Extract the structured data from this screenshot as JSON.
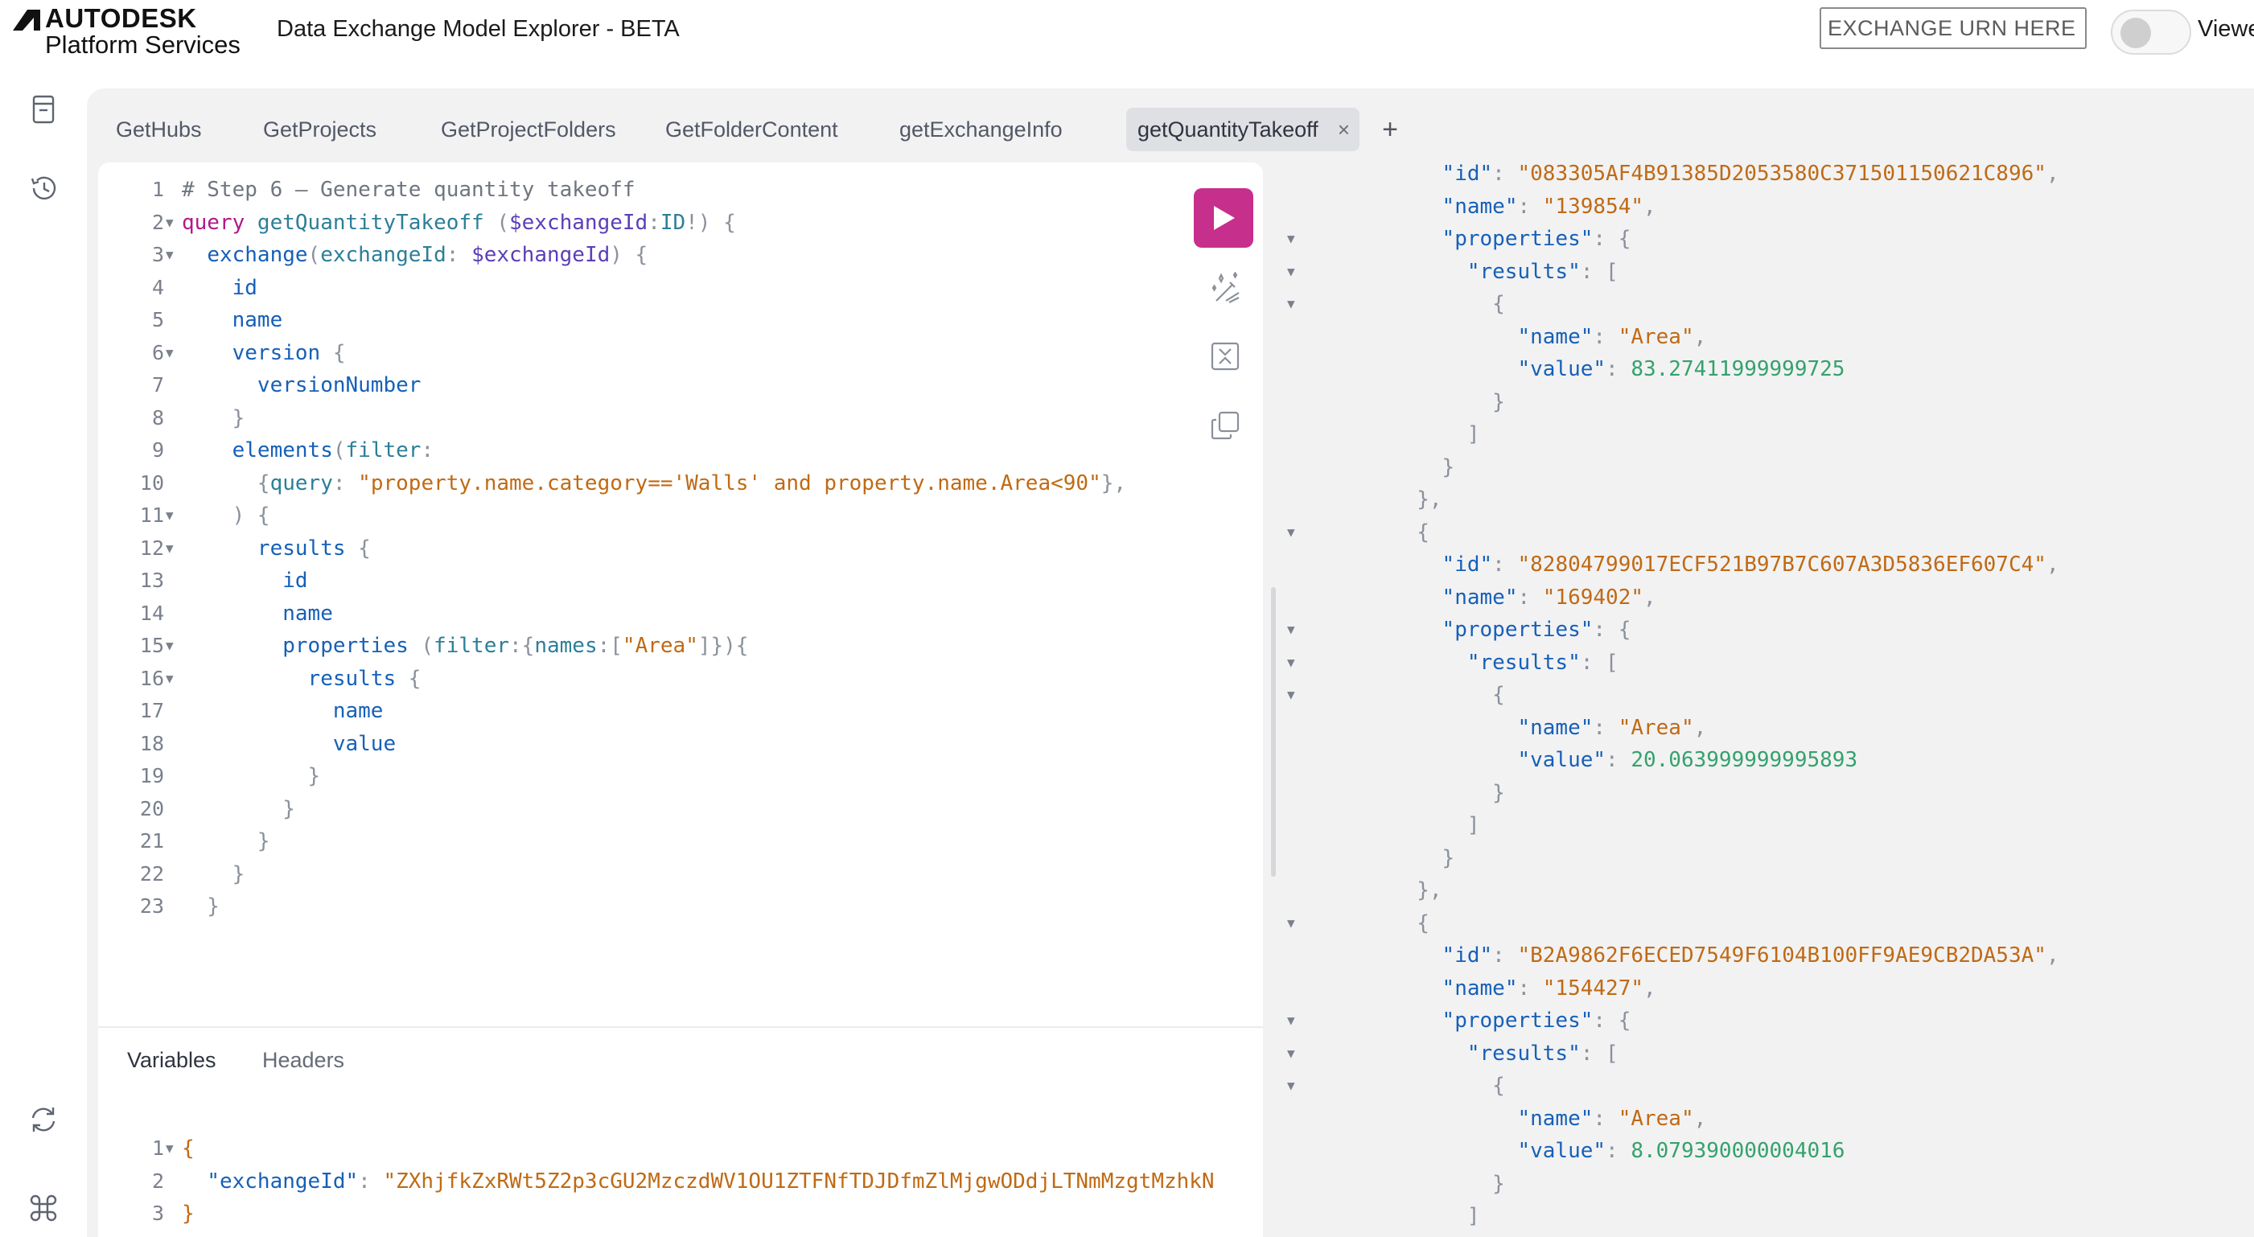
{
  "header": {
    "logo_line1": "AUTODESK",
    "logo_line2": "Platform Services",
    "title": "Data Exchange Model Explorer - BETA",
    "urn_placeholder": "EXCHANGE URN HERE",
    "viewer_label": "Viewer"
  },
  "sidebar": {
    "icons": [
      "document-icon",
      "history-icon",
      "refresh-icon",
      "command-icon"
    ]
  },
  "tabs": [
    {
      "label": "GetHubs",
      "active": false
    },
    {
      "label": "GetProjects",
      "active": false
    },
    {
      "label": "GetProjectFolders",
      "active": false
    },
    {
      "label": "GetFolderContent",
      "active": false
    },
    {
      "label": "getExchangeInfo",
      "active": false
    },
    {
      "label": "getQuantityTakeoff",
      "active": true
    }
  ],
  "tab_close": "×",
  "tab_add": "+",
  "editor": {
    "lines": [
      {
        "n": "1",
        "fold": false,
        "tokens": [
          [
            "t-com",
            "# Step 6 – Generate quantity takeoff"
          ]
        ]
      },
      {
        "n": "2",
        "fold": true,
        "tokens": [
          [
            "t-kw",
            "query "
          ],
          [
            "t-fn",
            "getQuantityTakeoff "
          ],
          [
            "t-p",
            "("
          ],
          [
            "t-var",
            "$exchangeId"
          ],
          [
            "t-p",
            ":"
          ],
          [
            "t-arg",
            "ID"
          ],
          [
            "t-p",
            "!) {"
          ]
        ]
      },
      {
        "n": "3",
        "fold": true,
        "tokens": [
          [
            "t-p",
            "  "
          ],
          [
            "t-fld",
            "exchange"
          ],
          [
            "t-p",
            "("
          ],
          [
            "t-arg",
            "exchangeId"
          ],
          [
            "t-p",
            ": "
          ],
          [
            "t-var",
            "$exchangeId"
          ],
          [
            "t-p",
            ") {"
          ]
        ]
      },
      {
        "n": "4",
        "fold": false,
        "tokens": [
          [
            "t-p",
            "    "
          ],
          [
            "t-fld",
            "id"
          ]
        ]
      },
      {
        "n": "5",
        "fold": false,
        "tokens": [
          [
            "t-p",
            "    "
          ],
          [
            "t-fld",
            "name"
          ]
        ]
      },
      {
        "n": "6",
        "fold": true,
        "tokens": [
          [
            "t-p",
            "    "
          ],
          [
            "t-fld",
            "version"
          ],
          [
            "t-p",
            " {"
          ]
        ]
      },
      {
        "n": "7",
        "fold": false,
        "tokens": [
          [
            "t-p",
            "      "
          ],
          [
            "t-fld",
            "versionNumber"
          ]
        ]
      },
      {
        "n": "8",
        "fold": false,
        "tokens": [
          [
            "t-p",
            "    }"
          ]
        ]
      },
      {
        "n": "9",
        "fold": false,
        "tokens": [
          [
            "t-p",
            "    "
          ],
          [
            "t-fld",
            "elements"
          ],
          [
            "t-p",
            "("
          ],
          [
            "t-arg",
            "filter"
          ],
          [
            "t-p",
            ":"
          ]
        ]
      },
      {
        "n": "10",
        "fold": false,
        "tokens": [
          [
            "t-p",
            "      {"
          ],
          [
            "t-arg",
            "query"
          ],
          [
            "t-p",
            ": "
          ],
          [
            "t-str",
            "\"property.name.category=='Walls' and property.name.Area<90\""
          ],
          [
            "t-p",
            "},"
          ]
        ]
      },
      {
        "n": "11",
        "fold": true,
        "tokens": [
          [
            "t-p",
            "    ) {"
          ]
        ]
      },
      {
        "n": "12",
        "fold": true,
        "tokens": [
          [
            "t-p",
            "      "
          ],
          [
            "t-fld",
            "results"
          ],
          [
            "t-p",
            " {"
          ]
        ]
      },
      {
        "n": "13",
        "fold": false,
        "tokens": [
          [
            "t-p",
            "        "
          ],
          [
            "t-fld",
            "id"
          ]
        ]
      },
      {
        "n": "14",
        "fold": false,
        "tokens": [
          [
            "t-p",
            "        "
          ],
          [
            "t-fld",
            "name"
          ]
        ]
      },
      {
        "n": "15",
        "fold": true,
        "tokens": [
          [
            "t-p",
            "        "
          ],
          [
            "t-fld",
            "properties"
          ],
          [
            "t-p",
            " ("
          ],
          [
            "t-arg",
            "filter"
          ],
          [
            "t-p",
            ":{"
          ],
          [
            "t-arg",
            "names"
          ],
          [
            "t-p",
            ":["
          ],
          [
            "t-str",
            "\"Area\""
          ],
          [
            "t-p",
            "]}){"
          ]
        ]
      },
      {
        "n": "16",
        "fold": true,
        "tokens": [
          [
            "t-p",
            "          "
          ],
          [
            "t-fld",
            "results"
          ],
          [
            "t-p",
            " {"
          ]
        ]
      },
      {
        "n": "17",
        "fold": false,
        "tokens": [
          [
            "t-p",
            "            "
          ],
          [
            "t-fld",
            "name"
          ]
        ]
      },
      {
        "n": "18",
        "fold": false,
        "tokens": [
          [
            "t-p",
            "            "
          ],
          [
            "t-fld",
            "value"
          ]
        ]
      },
      {
        "n": "19",
        "fold": false,
        "tokens": [
          [
            "t-p",
            "          }"
          ]
        ]
      },
      {
        "n": "20",
        "fold": false,
        "tokens": [
          [
            "t-p",
            "        }"
          ]
        ]
      },
      {
        "n": "21",
        "fold": false,
        "tokens": [
          [
            "t-p",
            "      }"
          ]
        ]
      },
      {
        "n": "22",
        "fold": false,
        "tokens": [
          [
            "t-p",
            "    }"
          ]
        ]
      },
      {
        "n": "23",
        "fold": false,
        "tokens": [
          [
            "t-p",
            "  }"
          ]
        ]
      }
    ]
  },
  "toolbar": {
    "run": "play-icon",
    "prettify": "magic-wand-icon",
    "merge": "merge-fragments-icon",
    "copy": "copy-icon"
  },
  "variables": {
    "tab_variables": "Variables",
    "tab_headers": "Headers",
    "lines": [
      {
        "n": "1",
        "fold": true,
        "tokens": [
          [
            "t-str",
            "{"
          ]
        ]
      },
      {
        "n": "2",
        "fold": false,
        "tokens": [
          [
            "t-p",
            "  "
          ],
          [
            "t-fld",
            "\"exchangeId\""
          ],
          [
            "t-p",
            ": "
          ],
          [
            "t-str",
            "\"ZXhjfkZxRWt5Z2p3cGU2MzczdWV1OU1ZTFNfTDJDfmZlMjgwODdjLTNmMzgtMzhkN"
          ]
        ]
      },
      {
        "n": "3",
        "fold": false,
        "tokens": [
          [
            "t-str",
            "}"
          ]
        ]
      }
    ]
  },
  "results": {
    "lines": [
      {
        "fold": false,
        "tokens": [
          [
            "t-p",
            "          "
          ],
          [
            "t-fld",
            "\"id\""
          ],
          [
            "t-p",
            ": "
          ],
          [
            "t-str",
            "\"083305AF4B91385D2053580C371501150621C896\""
          ],
          [
            "t-p",
            ","
          ]
        ]
      },
      {
        "fold": false,
        "tokens": [
          [
            "t-p",
            "          "
          ],
          [
            "t-fld",
            "\"name\""
          ],
          [
            "t-p",
            ": "
          ],
          [
            "t-str",
            "\"139854\""
          ],
          [
            "t-p",
            ","
          ]
        ]
      },
      {
        "fold": true,
        "tokens": [
          [
            "t-p",
            "          "
          ],
          [
            "t-fld",
            "\"properties\""
          ],
          [
            "t-p",
            ": {"
          ]
        ]
      },
      {
        "fold": true,
        "tokens": [
          [
            "t-p",
            "            "
          ],
          [
            "t-fld",
            "\"results\""
          ],
          [
            "t-p",
            ": ["
          ]
        ]
      },
      {
        "fold": true,
        "tokens": [
          [
            "t-p",
            "              {"
          ]
        ]
      },
      {
        "fold": false,
        "tokens": [
          [
            "t-p",
            "                "
          ],
          [
            "t-fld",
            "\"name\""
          ],
          [
            "t-p",
            ": "
          ],
          [
            "t-str",
            "\"Area\""
          ],
          [
            "t-p",
            ","
          ]
        ]
      },
      {
        "fold": false,
        "tokens": [
          [
            "t-p",
            "                "
          ],
          [
            "t-fld",
            "\"value\""
          ],
          [
            "t-p",
            ": "
          ],
          [
            "t-num",
            "83.27411999999725"
          ]
        ]
      },
      {
        "fold": false,
        "tokens": [
          [
            "t-p",
            "              }"
          ]
        ]
      },
      {
        "fold": false,
        "tokens": [
          [
            "t-p",
            "            ]"
          ]
        ]
      },
      {
        "fold": false,
        "tokens": [
          [
            "t-p",
            "          }"
          ]
        ]
      },
      {
        "fold": false,
        "tokens": [
          [
            "t-p",
            "        },"
          ]
        ]
      },
      {
        "fold": true,
        "tokens": [
          [
            "t-p",
            "        {"
          ]
        ]
      },
      {
        "fold": false,
        "tokens": [
          [
            "t-p",
            "          "
          ],
          [
            "t-fld",
            "\"id\""
          ],
          [
            "t-p",
            ": "
          ],
          [
            "t-str",
            "\"82804799017ECF521B97B7C607A3D5836EF607C4\""
          ],
          [
            "t-p",
            ","
          ]
        ]
      },
      {
        "fold": false,
        "tokens": [
          [
            "t-p",
            "          "
          ],
          [
            "t-fld",
            "\"name\""
          ],
          [
            "t-p",
            ": "
          ],
          [
            "t-str",
            "\"169402\""
          ],
          [
            "t-p",
            ","
          ]
        ]
      },
      {
        "fold": true,
        "tokens": [
          [
            "t-p",
            "          "
          ],
          [
            "t-fld",
            "\"properties\""
          ],
          [
            "t-p",
            ": {"
          ]
        ]
      },
      {
        "fold": true,
        "tokens": [
          [
            "t-p",
            "            "
          ],
          [
            "t-fld",
            "\"results\""
          ],
          [
            "t-p",
            ": ["
          ]
        ]
      },
      {
        "fold": true,
        "tokens": [
          [
            "t-p",
            "              {"
          ]
        ]
      },
      {
        "fold": false,
        "tokens": [
          [
            "t-p",
            "                "
          ],
          [
            "t-fld",
            "\"name\""
          ],
          [
            "t-p",
            ": "
          ],
          [
            "t-str",
            "\"Area\""
          ],
          [
            "t-p",
            ","
          ]
        ]
      },
      {
        "fold": false,
        "tokens": [
          [
            "t-p",
            "                "
          ],
          [
            "t-fld",
            "\"value\""
          ],
          [
            "t-p",
            ": "
          ],
          [
            "t-num",
            "20.063999999995893"
          ]
        ]
      },
      {
        "fold": false,
        "tokens": [
          [
            "t-p",
            "              }"
          ]
        ]
      },
      {
        "fold": false,
        "tokens": [
          [
            "t-p",
            "            ]"
          ]
        ]
      },
      {
        "fold": false,
        "tokens": [
          [
            "t-p",
            "          }"
          ]
        ]
      },
      {
        "fold": false,
        "tokens": [
          [
            "t-p",
            "        },"
          ]
        ]
      },
      {
        "fold": true,
        "tokens": [
          [
            "t-p",
            "        {"
          ]
        ]
      },
      {
        "fold": false,
        "tokens": [
          [
            "t-p",
            "          "
          ],
          [
            "t-fld",
            "\"id\""
          ],
          [
            "t-p",
            ": "
          ],
          [
            "t-str",
            "\"B2A9862F6ECED7549F6104B100FF9AE9CB2DA53A\""
          ],
          [
            "t-p",
            ","
          ]
        ]
      },
      {
        "fold": false,
        "tokens": [
          [
            "t-p",
            "          "
          ],
          [
            "t-fld",
            "\"name\""
          ],
          [
            "t-p",
            ": "
          ],
          [
            "t-str",
            "\"154427\""
          ],
          [
            "t-p",
            ","
          ]
        ]
      },
      {
        "fold": true,
        "tokens": [
          [
            "t-p",
            "          "
          ],
          [
            "t-fld",
            "\"properties\""
          ],
          [
            "t-p",
            ": {"
          ]
        ]
      },
      {
        "fold": true,
        "tokens": [
          [
            "t-p",
            "            "
          ],
          [
            "t-fld",
            "\"results\""
          ],
          [
            "t-p",
            ": ["
          ]
        ]
      },
      {
        "fold": true,
        "tokens": [
          [
            "t-p",
            "              {"
          ]
        ]
      },
      {
        "fold": false,
        "tokens": [
          [
            "t-p",
            "                "
          ],
          [
            "t-fld",
            "\"name\""
          ],
          [
            "t-p",
            ": "
          ],
          [
            "t-str",
            "\"Area\""
          ],
          [
            "t-p",
            ","
          ]
        ]
      },
      {
        "fold": false,
        "tokens": [
          [
            "t-p",
            "                "
          ],
          [
            "t-fld",
            "\"value\""
          ],
          [
            "t-p",
            ": "
          ],
          [
            "t-num",
            "8.079390000004016"
          ]
        ]
      },
      {
        "fold": false,
        "tokens": [
          [
            "t-p",
            "              }"
          ]
        ]
      },
      {
        "fold": false,
        "tokens": [
          [
            "t-p",
            "            ]"
          ]
        ]
      }
    ]
  },
  "colors": {
    "accent": "#c72f8c",
    "keyword": "#b1188a",
    "field": "#1660b8",
    "string": "#c06a14",
    "number": "#35a26c",
    "panel": "#f2f2f3"
  }
}
